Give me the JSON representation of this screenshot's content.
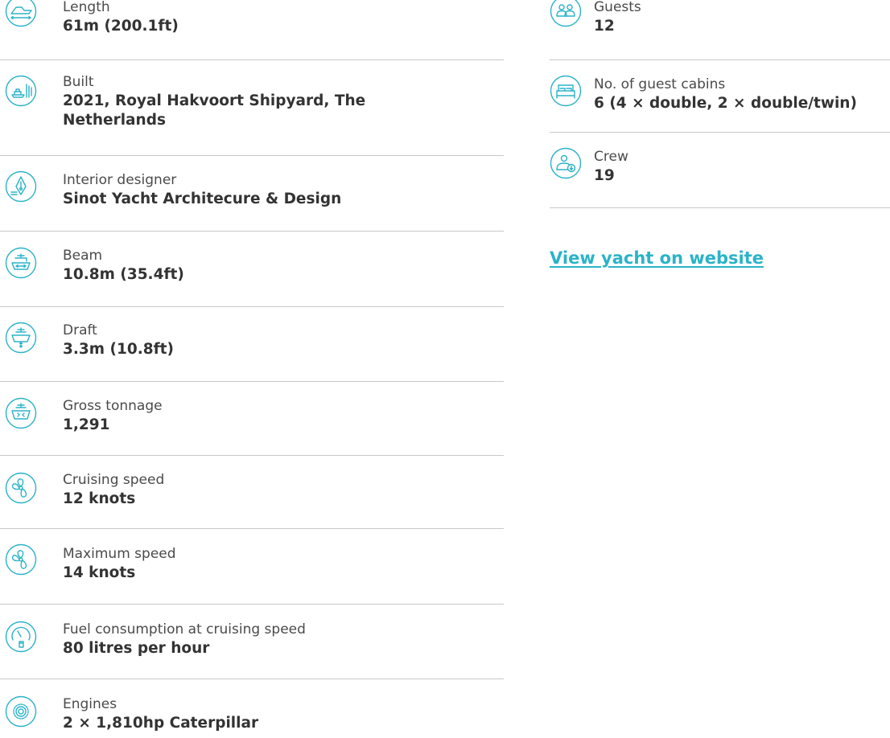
{
  "accent_color": "#2bb3c8",
  "left_specs": [
    {
      "label": "Length",
      "value": "61m (200.1ft)",
      "icon": "yacht-length-icon"
    },
    {
      "label": "Built",
      "value": "2021, Royal Hakvoort Shipyard, The Netherlands",
      "icon": "shipyard-icon"
    },
    {
      "label": "Interior designer",
      "value": "Sinot Yacht Architecure & Design",
      "icon": "pen-nib-icon"
    },
    {
      "label": "Beam",
      "value": "10.8m (35.4ft)",
      "icon": "yacht-beam-icon"
    },
    {
      "label": "Draft",
      "value": "3.3m (10.8ft)",
      "icon": "yacht-draft-icon"
    },
    {
      "label": "Gross tonnage",
      "value": "1,291",
      "icon": "yacht-tonnage-icon"
    },
    {
      "label": "Cruising speed",
      "value": "12 knots",
      "icon": "propeller-icon"
    },
    {
      "label": "Maximum speed",
      "value": "14 knots",
      "icon": "propeller-icon"
    },
    {
      "label": "Fuel consumption at cruising speed",
      "value": "80 litres per hour",
      "icon": "fuel-gauge-icon"
    },
    {
      "label": "Engines",
      "value": "2 × 1,810hp Caterpillar",
      "icon": "engine-gear-icon"
    }
  ],
  "right_specs": [
    {
      "label": "Guests",
      "value": "12",
      "icon": "guests-icon"
    },
    {
      "label": "No. of guest cabins",
      "value": "6 (4 × double, 2 × double/twin)",
      "icon": "bed-icon"
    },
    {
      "label": "Crew",
      "value": "19",
      "icon": "crew-icon"
    }
  ],
  "view_link": "View yacht on website"
}
